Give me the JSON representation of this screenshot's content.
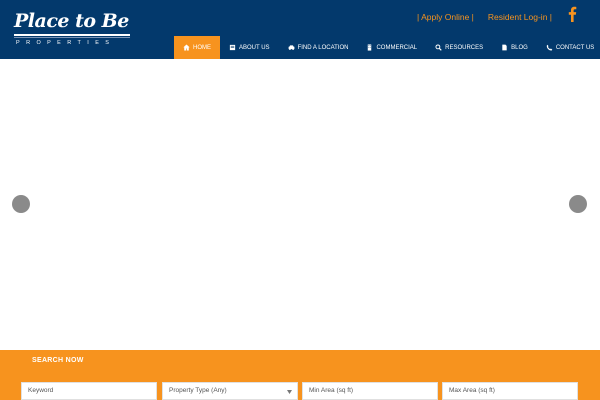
{
  "logo": {
    "title": "Place to Be",
    "subtitle": "PROPERTIES"
  },
  "top_links": {
    "apply": "| Apply Online |",
    "resident": "Resident Log-in |"
  },
  "social": {
    "icon": "facebook-icon"
  },
  "nav": {
    "items": [
      {
        "label": "HOME",
        "icon": "home-icon",
        "active": true
      },
      {
        "label": "ABOUT US",
        "icon": "book-icon",
        "active": false
      },
      {
        "label": "FIND A LOCATION",
        "icon": "car-icon",
        "active": false
      },
      {
        "label": "COMMERCIAL",
        "icon": "building-icon",
        "active": false
      },
      {
        "label": "RESOURCES",
        "icon": "search-icon",
        "active": false
      },
      {
        "label": "BLOG",
        "icon": "document-icon",
        "active": false
      },
      {
        "label": "CONTACT US",
        "icon": "phone-icon",
        "active": false
      }
    ]
  },
  "slider": {
    "prev_icon": "chevron-left-icon",
    "next_icon": "chevron-right-icon"
  },
  "search": {
    "title": "SEARCH NOW",
    "keyword_placeholder": "Keyword",
    "property_type_selected": "Property Type (Any)",
    "min_area_placeholder": "Min Area (sq ft)",
    "max_area_placeholder": "Max Area (sq ft)"
  },
  "colors": {
    "header_bg": "#03396c",
    "accent": "#f7931e",
    "arrow": "#8a8a8a"
  }
}
